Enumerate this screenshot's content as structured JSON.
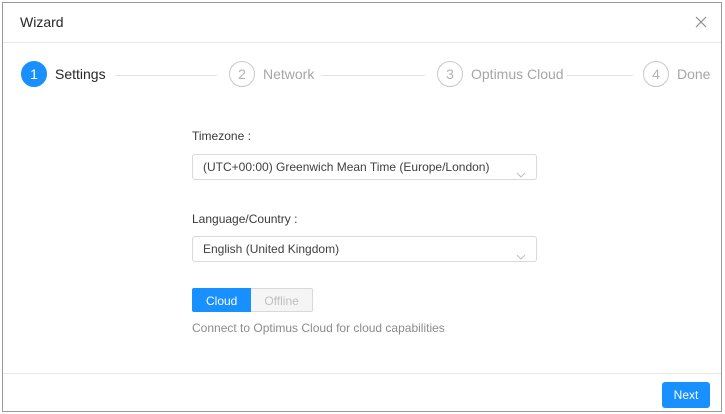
{
  "dialog": {
    "title": "Wizard",
    "close_icon": "close-icon"
  },
  "steps": [
    {
      "number": "1",
      "label": "Settings",
      "state": "active"
    },
    {
      "number": "2",
      "label": "Network",
      "state": "pending"
    },
    {
      "number": "3",
      "label": "Optimus Cloud",
      "state": "pending"
    },
    {
      "number": "4",
      "label": "Done",
      "state": "pending"
    }
  ],
  "form": {
    "timezone": {
      "label": "Timezone :",
      "value": "(UTC+00:00) Greenwich Mean Time (Europe/London)"
    },
    "language": {
      "label": "Language/Country :",
      "value": "English (United Kingdom)"
    },
    "mode": {
      "options": [
        "Cloud",
        "Offline"
      ],
      "selected": "Cloud",
      "help": "Connect to Optimus Cloud for cloud capabilities"
    }
  },
  "footer": {
    "next_label": "Next"
  },
  "colors": {
    "accent": "#1890ff",
    "border": "#d9d9d9",
    "muted_text": "#8c8c8c"
  }
}
